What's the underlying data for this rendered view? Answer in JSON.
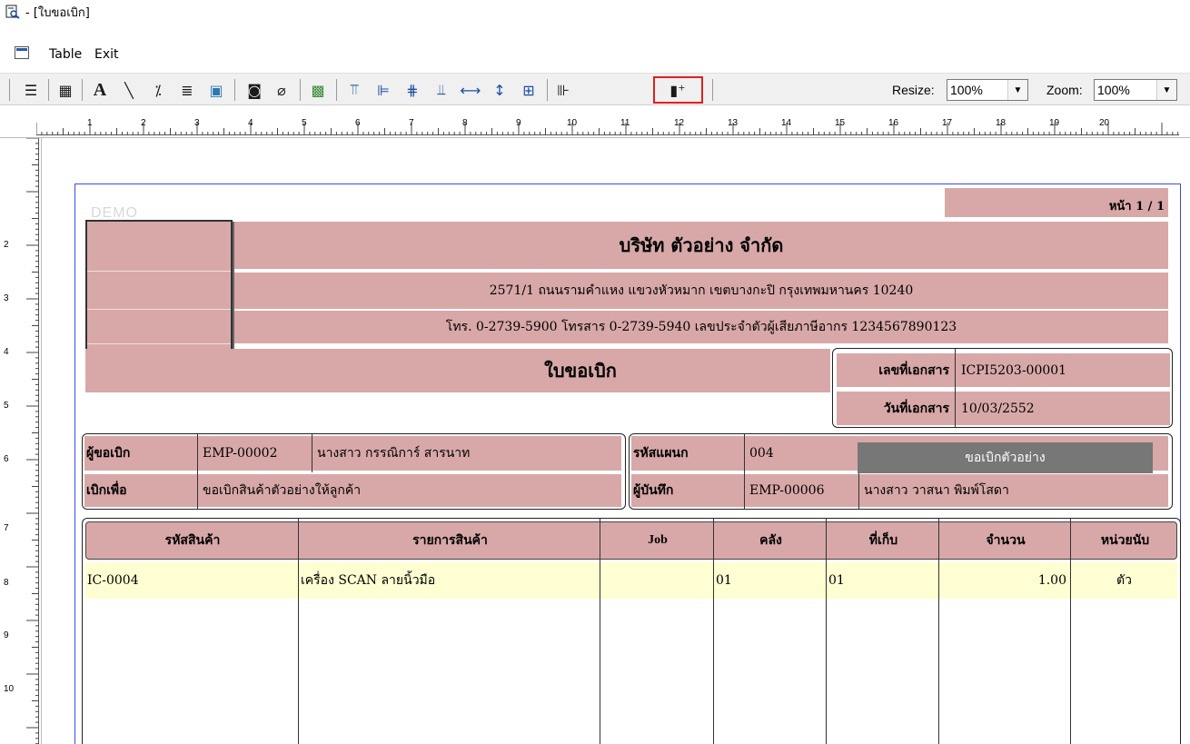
{
  "window": {
    "title": "- [ใบขอเบิก]"
  },
  "menu": {
    "items": [
      "Table",
      "Exit"
    ]
  },
  "toolbar": {
    "resize_label": "Resize:",
    "resize_value": "100%",
    "zoom_label": "Zoom:",
    "zoom_value": "100%",
    "highlight_color": "#e02020"
  },
  "ruler": {
    "h_numbers": [
      "1",
      "2",
      "3",
      "4",
      "5",
      "6",
      "7",
      "8",
      "9",
      "10",
      "11",
      "12",
      "13",
      "14",
      "15",
      "16",
      "17",
      "18",
      "19",
      "20"
    ],
    "v_numbers": [
      "2",
      "3",
      "4",
      "5",
      "6",
      "7",
      "8",
      "9",
      "10"
    ]
  },
  "report": {
    "watermark": "DEMO",
    "page_no": "หน้า 1 / 1",
    "company": "บริษัท ตัวอย่าง จำกัด",
    "address": "2571/1 ถนนรามคำแหง แขวงหัวหมาก เขตบางกะปิ กรุงเทพมหานคร 10240",
    "phone": "โทร. 0-2739-5900  โทรสาร 0-2739-5940  เลขประจำตัวผู้เสียภาษีอากร 1234567890123",
    "doc_title": "ใบขอเบิก",
    "doc_no_label": "เลขที่เอกสาร",
    "doc_no": "ICPI5203-00001",
    "doc_date_label": "วันที่เอกสาร",
    "doc_date": "10/03/2552",
    "requester_label": "ผู้ขอเบิก",
    "requester_code": "EMP-00002",
    "requester_name": "นางสาว กรรณิการ์ สารนาท",
    "purpose_label": "เบิกเพื่อ",
    "purpose": "ขอเบิกสินค้าตัวอย่างให้ลูกค้า",
    "dept_label": "รหัสแผนก",
    "dept_code": "004",
    "recorder_label": "ผู้บันทึก",
    "recorder_code": "EMP-00006",
    "recorder_name": "นางสาว วาสนา  พิมพ์โสดา",
    "stamp": "ขอเบิกตัวอย่าง",
    "colors": {
      "pink": "#d8a8a8",
      "row": "#fefed2",
      "stamp": "#777777",
      "border": "#3a48e8"
    }
  },
  "items": {
    "headers": [
      "รหัสสินค้า",
      "รายการสินค้า",
      "Job",
      "คลัง",
      "ที่เก็บ",
      "จำนวน",
      "หน่วยนับ"
    ],
    "rows": [
      {
        "code": "IC-0004",
        "name": "เครื่อง SCAN ลายนิ้วมือ",
        "job": "",
        "warehouse": "01",
        "location": "01",
        "qty": "1.00",
        "unit": "ตัว"
      }
    ]
  }
}
